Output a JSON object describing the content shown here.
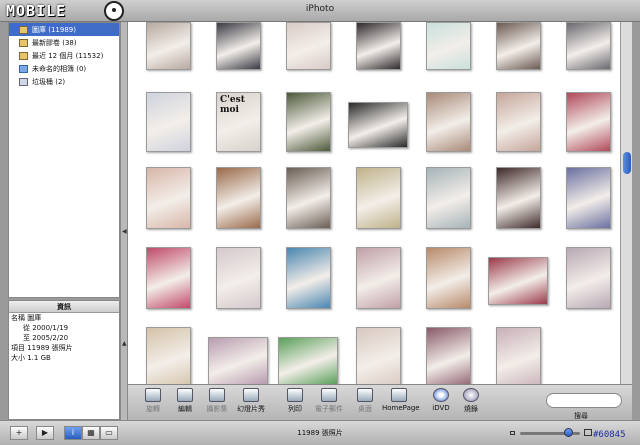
{
  "window": {
    "title": "iPhoto"
  },
  "brand": {
    "text": "MOBILE"
  },
  "source_list": [
    {
      "label": "圖庫 (11989)",
      "selected": true,
      "icon": "library-icon"
    },
    {
      "label": "最新膠卷 (38)",
      "selected": false,
      "icon": "film-roll-icon"
    },
    {
      "label": "最近 12 個月 (11532)",
      "selected": false,
      "icon": "calendar-icon"
    },
    {
      "label": "未命名的相簿 (0)",
      "selected": false,
      "icon": "album-icon"
    },
    {
      "label": "垃圾桶 (2)",
      "selected": false,
      "icon": "trash-icon"
    }
  ],
  "info": {
    "header": "資訊",
    "rows": [
      "名稱 圖庫",
      "從 2000/1/19",
      "至 2005/2/20",
      "項目 11989 張照片",
      "大小 1.1 GB"
    ]
  },
  "photos": [
    {
      "caption": "",
      "color": "#b7a9a0"
    },
    {
      "caption": "",
      "color": "#3a3a44"
    },
    {
      "caption": "",
      "color": "#d9cbc6"
    },
    {
      "caption": "",
      "color": "#2e2a2c"
    },
    {
      "caption": "",
      "color": "#c9e0dc"
    },
    {
      "caption": "",
      "color": "#6b5a52"
    },
    {
      "caption": "",
      "color": "#6a6870"
    },
    {
      "caption": "",
      "color": "#cfd3de"
    },
    {
      "caption": "C'est moi",
      "color": "#d8d2cc"
    },
    {
      "caption": "",
      "color": "#4c5a3a"
    },
    {
      "caption": "",
      "color": "#2a2a2a"
    },
    {
      "caption": "",
      "color": "#a88a78"
    },
    {
      "caption": "",
      "color": "#c5a69a"
    },
    {
      "caption": "",
      "color": "#b04a5a"
    },
    {
      "caption": "",
      "color": "#d8b6a8"
    },
    {
      "caption": "",
      "color": "#9a6a4a"
    },
    {
      "caption": "",
      "color": "#6a5e54"
    },
    {
      "caption": "",
      "color": "#bfb28a"
    },
    {
      "caption": "",
      "color": "#a6b3b8"
    },
    {
      "caption": "",
      "color": "#3e2a2a"
    },
    {
      "caption": "",
      "color": "#6a70a0"
    },
    {
      "caption": "",
      "color": "#c04a6a"
    },
    {
      "caption": "",
      "color": "#d4c8cc"
    },
    {
      "caption": "",
      "color": "#4a86b0"
    },
    {
      "caption": "",
      "color": "#c0a0a8"
    },
    {
      "caption": "",
      "color": "#b88a6a"
    },
    {
      "caption": "",
      "color": "#9a3a4a"
    },
    {
      "caption": "",
      "color": "#b8a8b4"
    },
    {
      "caption": "",
      "color": "#d4c2a8"
    },
    {
      "caption": "",
      "color": "#b89cb0"
    },
    {
      "caption": "",
      "color": "#5aa05a"
    },
    {
      "caption": "",
      "color": "#d8c8c0"
    },
    {
      "caption": "",
      "color": "#8a5a6a"
    },
    {
      "caption": "",
      "color": "#c8b0b8"
    }
  ],
  "toolbar": [
    {
      "label": "旋轉",
      "icon": "rotate-icon",
      "enabled": false
    },
    {
      "label": "編輯",
      "icon": "edit-icon",
      "enabled": true
    },
    {
      "label": "攝影集",
      "icon": "book-icon",
      "enabled": false
    },
    {
      "label": "幻燈片秀",
      "icon": "slideshow-icon",
      "enabled": true
    },
    {
      "label": "列印",
      "icon": "print-icon",
      "enabled": true
    },
    {
      "label": "電子郵件",
      "icon": "email-icon",
      "enabled": false
    },
    {
      "label": "桌面",
      "icon": "desktop-icon",
      "enabled": false
    },
    {
      "label": "HomePage",
      "icon": "homepage-icon",
      "enabled": true
    },
    {
      "label": "iDVD",
      "icon": "idvd-icon",
      "enabled": true
    },
    {
      "label": "燒錄",
      "icon": "burn-icon",
      "enabled": true
    }
  ],
  "search": {
    "label": "搜尋",
    "value": ""
  },
  "status": {
    "count": "11989 張照片"
  },
  "status_buttons": [
    {
      "glyph": "+",
      "icon": "add-icon"
    },
    {
      "glyph": "▶",
      "icon": "play-icon"
    },
    {
      "glyph": "i",
      "icon": "info-icon"
    },
    {
      "glyph": "▦",
      "icon": "calendar-icon"
    },
    {
      "glyph": "▭",
      "icon": "keyword-icon"
    }
  ],
  "zoom": {
    "level": 0.8
  },
  "watermark": "#60845"
}
